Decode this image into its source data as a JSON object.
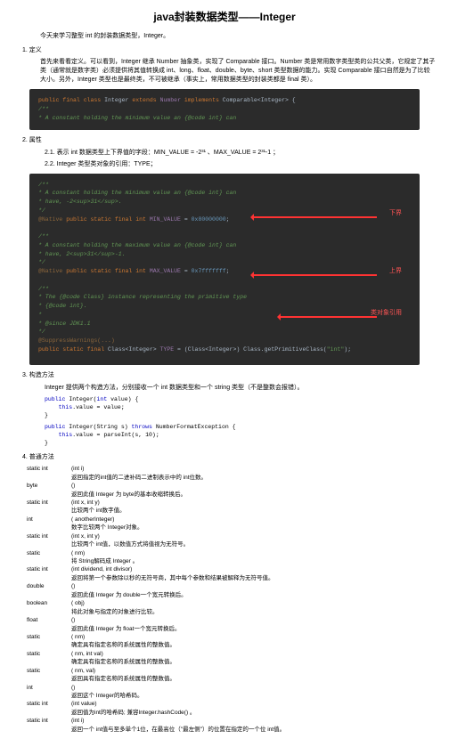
{
  "title": "java封装数据类型——Integer",
  "intro": "今天来学习整型 int 的封装数据类型，Integer。",
  "s1_title": "1. 定义",
  "s1_para": "首先来看看定义。可以看到，Integer 继承 Number 抽象类，实现了 Comparable 接口。Number 类是常用数字类型类的公共父类，它规定了其子类（通常就是数字类）必须提供将其值转换成 int、long、float、double、byte、short 类型数据的能力。实现 Comparable 接口自然是为了比较大小。另外，Integer 类型也是最终类，不可被继承（事实上，常用数据类型的封装类都是 final 类）。",
  "code1_l1a": "public final class ",
  "code1_l1b": "Integer ",
  "code1_l1c": "extends ",
  "code1_l1d": "Number ",
  "code1_l1e": "implements ",
  "code1_l1f": "Comparable<Integer> {",
  "code1_l2": "    /**",
  "code1_l3": "     * A constant holding the minimum value an {@code int} can",
  "s2_title": "2. 属性",
  "s2_1": "2.1. 表示 int 数据类型上下界值的字段：MIN_VALUE = -2³¹ 、MAX_VALUE = 2³¹-1 ；",
  "s2_2": "2.2. Integer 类型类对象的引用：TYPE；",
  "code2_c1": "/**",
  "code2_c2": " * A constant holding the minimum value an {@code int} can",
  "code2_c3": " * have, -2<sup>31</sup>.",
  "code2_c4": " */",
  "code2_l1a": "@Native ",
  "code2_l1b": "public static final int   ",
  "code2_l1c": "MIN_VALUE",
  "code2_l1d": " = ",
  "code2_l1e": "0x80000000",
  "code2_l1f": ";",
  "code2_c5": "/**",
  "code2_c6": " * A constant holding the maximum value an {@code int} can",
  "code2_c7": " * have, 2<sup>31</sup>-1.",
  "code2_c8": " */",
  "code2_l2a": "@Native ",
  "code2_l2b": "public static final int   ",
  "code2_l2c": "MAX_VALUE",
  "code2_l2d": " = ",
  "code2_l2e": "0x7fffffff",
  "code2_l2f": ";",
  "code2_c9": "/**",
  "code2_c10": " * The {@code Class} instance representing the primitive type",
  "code2_c11": " * {@code int}.",
  "code2_c12": " *",
  "code2_c13": " * @since   JDK1.1",
  "code2_c14": " */",
  "code2_sup": "@SuppressWarnings(...)",
  "code2_l3a": "public static final ",
  "code2_l3b": "Class<Integer>  ",
  "code2_l3c": "TYPE ",
  "code2_l3d": "= (Class<Integer>) Class.getPrimitiveClass(",
  "code2_l3e": "\"int\"",
  "code2_l3f": ");",
  "lbl_down": "下界",
  "lbl_up": "上界",
  "lbl_type": "类对象引用",
  "s3_title": "3. 构造方法",
  "s3_para": "Integer 提供两个构造方法，分别接收一个 int 数据类型和一个 string 类型（不是整数会报错）。",
  "code3a_l1": "public Integer(int value) {",
  "code3a_l2": "    this.value = value;",
  "code3a_l3": "}",
  "code3b_l1": "public Integer(String s) throws NumberFormatException {",
  "code3b_l2": "    this.value = parseInt(s, 10);",
  "code3b_l3": "}",
  "s4_title": "4. 普通方法",
  "rows": [
    {
      "t": "static int",
      "m": "(int i)",
      "d": "返回指定的int值的二进补码二进制表示中的 int位数。"
    },
    {
      "t": "byte",
      "m": "()",
      "d": "返回此值 Integer 为 byte的基本收缩转换后。"
    },
    {
      "t": "static int",
      "m": "(int x, int y)",
      "d": "比较两个 int数字值。"
    },
    {
      "t": "int",
      "m": "( anotherInteger)",
      "d": "数字比较两个 Integer对象。"
    },
    {
      "t": "static int",
      "m": "(int x, int y)",
      "d": "比较两个 int值，以数值方式将值视为无符号。"
    },
    {
      "t": "static",
      "m": "( nm)",
      "d": "将 String解码成 Integer 。"
    },
    {
      "t": "static int",
      "m": "(int dividend, int divisor)",
      "d": "返回将第一个参数除以秒的无符号商，其中每个参数和结果被解释为无符号值。"
    },
    {
      "t": "double",
      "m": "()",
      "d": "返回此值 Integer 为 double一个宽元转换后。"
    },
    {
      "t": "boolean",
      "m": "( obj)",
      "d": "将此对象与指定的对象进行比较。"
    },
    {
      "t": "float",
      "m": "()",
      "d": "返回此值 Integer 为 float一个宽元转换后。"
    },
    {
      "t": "static",
      "m": "( nm)",
      "d": "确定具有指定名称的系统属性的整数值。"
    },
    {
      "t": "static",
      "m": "( nm, int val)",
      "d": "确定具有指定名称的系统属性的整数值。"
    },
    {
      "t": "static",
      "m": "( nm, val)",
      "d": "返回具有指定名称的系统属性的整数值。"
    },
    {
      "t": "int",
      "m": "()",
      "d": "返回这个 Integer的哈希码。"
    },
    {
      "t": "static int",
      "m": "(int value)",
      "d": "返回值为int的哈希码; 兼容Integer.hashCode() 。"
    },
    {
      "t": "static int",
      "m": "(int i)",
      "d": "返回一个 int值与至多单个1位，在最高位（\"最左侧\"）的位置在指定的一个位 int值。"
    }
  ]
}
